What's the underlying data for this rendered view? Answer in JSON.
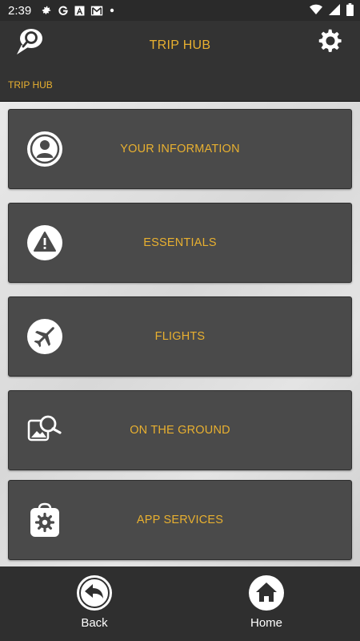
{
  "status_bar": {
    "time": "2:39",
    "left_icons": [
      "gear-icon",
      "google-icon",
      "font-icon",
      "gmail-icon",
      "dot-icon"
    ],
    "right_icons": [
      "wifi-icon",
      "signal-icon",
      "battery-icon"
    ]
  },
  "header": {
    "title": "TRIP HUB",
    "breadcrumb": "TRIP HUB",
    "left_icon": "chat-search-icon",
    "right_icon": "gear-icon"
  },
  "menu": {
    "items": [
      {
        "label": "YOUR INFORMATION",
        "icon": "user-icon"
      },
      {
        "label": "ESSENTIALS",
        "icon": "warning-icon"
      },
      {
        "label": "FLIGHTS",
        "icon": "airplane-icon"
      },
      {
        "label": "ON THE GROUND",
        "icon": "photo-search-icon"
      },
      {
        "label": "APP SERVICES",
        "icon": "bag-gear-icon"
      }
    ]
  },
  "bottom_nav": {
    "back_label": "Back",
    "home_label": "Home"
  },
  "colors": {
    "accent": "#e8b030",
    "card_bg": "#4a4a4a",
    "header_bg": "#333333",
    "nav_bg": "#2f2f2f"
  }
}
